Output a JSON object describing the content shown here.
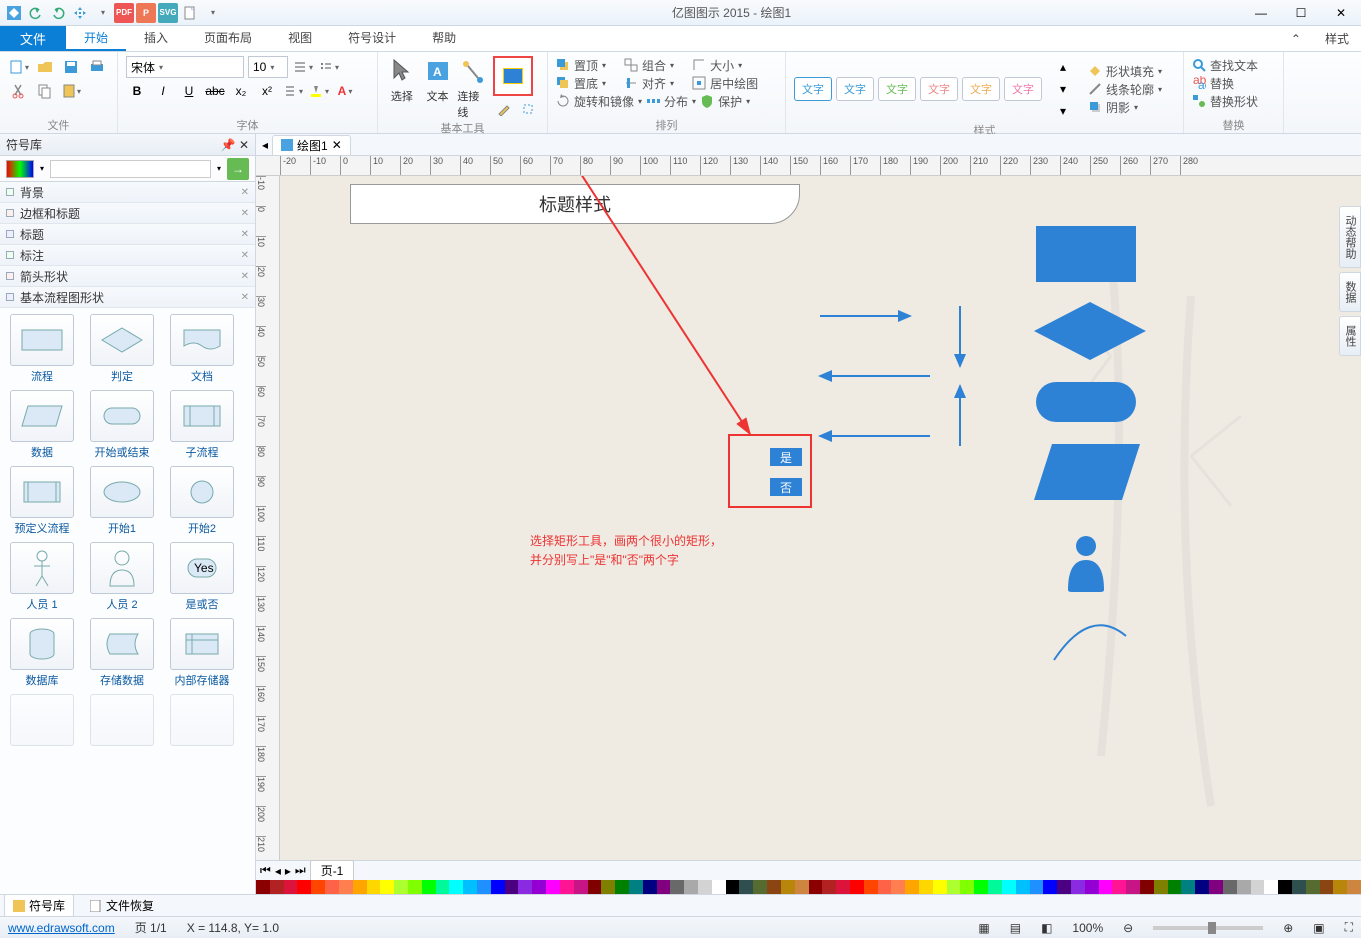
{
  "app_title": "亿图图示 2015 - 绘图1",
  "menu": {
    "file": "文件",
    "home": "开始",
    "insert": "插入",
    "pagelayout": "页面布局",
    "view": "视图",
    "symbol": "符号设计",
    "help": "帮助",
    "style_tab": "样式"
  },
  "ribbon": {
    "file_group": "文件",
    "font_group": "字体",
    "font_name": "宋体",
    "font_size": "10",
    "bold": "B",
    "italic": "I",
    "underline": "U",
    "basic_tools": "基本工具",
    "select": "选择",
    "text": "文本",
    "connect": "连接线",
    "arrange_group": "排列",
    "bring_front": "置顶",
    "send_back": "置底",
    "rotate": "旋转和镜像",
    "group": "组合",
    "align": "对齐",
    "distribute": "分布",
    "size": "大小",
    "center": "居中绘图",
    "protect": "保护",
    "style_group": "样式",
    "style_btn": "文字",
    "fill": "形状填充",
    "outline": "线条轮廓",
    "shadow": "阴影",
    "replace_group": "替换",
    "find": "查找文本",
    "replace": "替换",
    "replace_shape": "替换形状"
  },
  "symbol_panel": {
    "title": "符号库",
    "cats": [
      "背景",
      "边框和标题",
      "标题",
      "标注",
      "箭头形状",
      "基本流程图形状"
    ],
    "shapes": [
      [
        "流程",
        "判定",
        "文档"
      ],
      [
        "数据",
        "开始或结束",
        "子流程"
      ],
      [
        "预定义流程",
        "开始1",
        "开始2"
      ],
      [
        "人员 1",
        "人员 2",
        "是或否"
      ],
      [
        "数据库",
        "存储数据",
        "内部存储器"
      ]
    ],
    "yes_label": "Yes"
  },
  "doc_tab": "绘图1",
  "canvas": {
    "title_shape": "标题样式",
    "yes": "是",
    "no": "否",
    "annotation_l1": "选择矩形工具，画两个很小的矩形，",
    "annotation_l2": "并分别写上\"是\"和\"否\"两个字"
  },
  "right_tabs": [
    "动态帮助",
    "数据",
    "属性"
  ],
  "page_bar": "页-1",
  "bottom_tabs": {
    "lib": "符号库",
    "recover": "文件恢复"
  },
  "status": {
    "url": "www.edrawsoft.com",
    "pages": "页 1/1",
    "coords": "X = 114.8, Y= 1.0",
    "zoom": "100%"
  }
}
